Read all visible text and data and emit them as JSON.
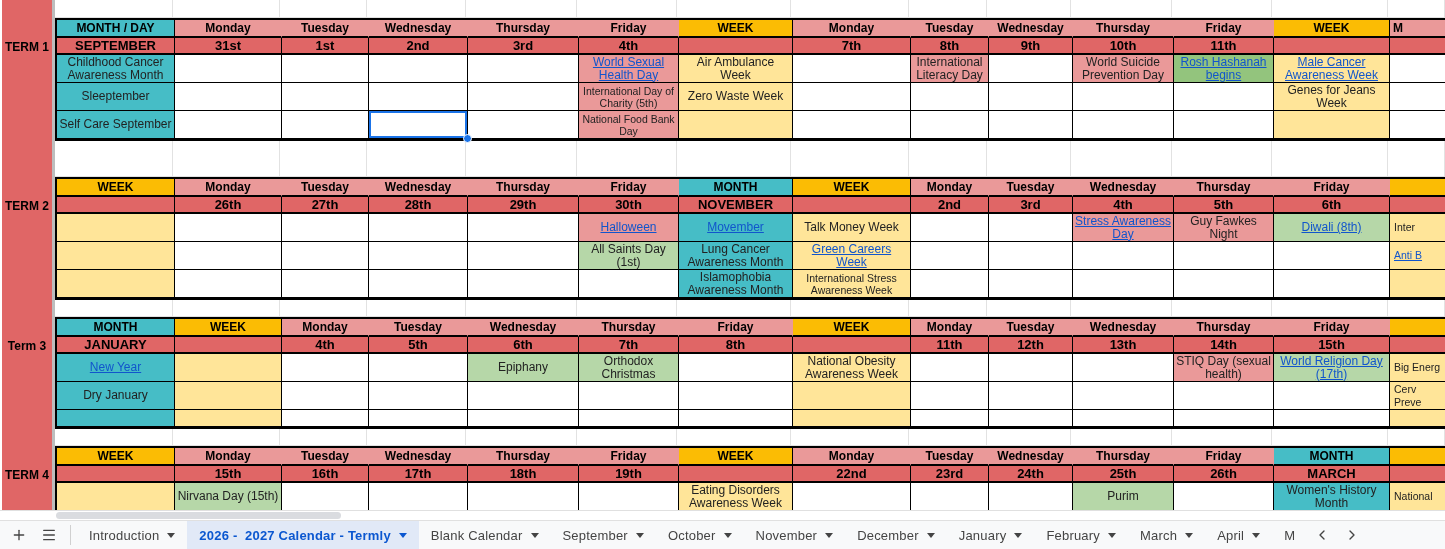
{
  "blocks": [
    {
      "label": "TERM 1",
      "columns": [
        {
          "kind": "month",
          "header": "MONTH / DAY",
          "date": "SEPTEMBER",
          "cells": [
            {
              "text": "Childhood Cancer Awareness Month",
              "selected": false
            },
            {
              "text": "Sleeptember",
              "selected": false
            },
            {
              "text": "Self Care September",
              "selected": false
            }
          ]
        },
        {
          "kind": "day",
          "header": "Monday",
          "date": "31st",
          "cells": [
            {
              "selected": false
            },
            {
              "selected": false
            },
            {
              "selected": false
            }
          ]
        },
        {
          "kind": "day",
          "header": "Tuesday",
          "date": "1st",
          "cells": [
            {
              "selected": false
            },
            {
              "selected": false
            },
            {
              "selected": false
            }
          ]
        },
        {
          "kind": "day",
          "header": "Wednesday",
          "date": "2nd",
          "cells": [
            {
              "selected": false
            },
            {
              "selected": false
            },
            {
              "selected": true
            }
          ]
        },
        {
          "kind": "day",
          "header": "Thursday",
          "date": "3rd",
          "cells": [
            {
              "selected": false
            },
            {
              "selected": false
            },
            {
              "selected": false
            }
          ]
        },
        {
          "kind": "day",
          "header": "Friday",
          "date": "4th",
          "cells": [
            {
              "text": "World Sexual Health Day",
              "link": true,
              "color": "#ea9999",
              "selected": false
            },
            {
              "text": "International Day of Charity (5th)",
              "small": true,
              "color": "#ea9999",
              "selected": false
            },
            {
              "text": "National Food Bank Day",
              "small": true,
              "color": "#ea9999",
              "selected": false
            }
          ]
        },
        {
          "kind": "week",
          "header": "WEEK",
          "cells": [
            {
              "text": "Air Ambulance Week",
              "selected": false
            },
            {
              "text": "Zero Waste Week",
              "selected": false
            },
            {
              "selected": false
            }
          ]
        },
        {
          "kind": "day",
          "header": "Monday",
          "date": "7th",
          "cells": [
            {
              "selected": false
            },
            {
              "selected": false
            },
            {
              "selected": false
            }
          ]
        },
        {
          "kind": "day",
          "header": "Tuesday",
          "date": "8th",
          "cells": [
            {
              "text": "International Literacy Day",
              "color": "#ea9999",
              "selected": false
            },
            {
              "selected": false
            },
            {
              "selected": false
            }
          ]
        },
        {
          "kind": "day",
          "header": "Wednesday",
          "date": "9th",
          "cells": [
            {
              "selected": false
            },
            {
              "selected": false
            },
            {
              "selected": false
            }
          ]
        },
        {
          "kind": "day",
          "header": "Thursday",
          "date": "10th",
          "cells": [
            {
              "text": "World Suicide Prevention Day",
              "color": "#ea9999",
              "selected": false
            },
            {
              "selected": false
            },
            {
              "selected": false
            }
          ]
        },
        {
          "kind": "day",
          "header": "Friday",
          "date": "11th",
          "cells": [
            {
              "text": "Rosh Hashanah begins",
              "link": true,
              "color": "#93c47d",
              "selected": false
            },
            {
              "selected": false
            },
            {
              "selected": false
            }
          ]
        },
        {
          "kind": "week",
          "header": "WEEK",
          "cells": [
            {
              "text": "Male Cancer Awareness Week",
              "link": true,
              "selected": false
            },
            {
              "text": "Genes for Jeans Week",
              "selected": false
            },
            {
              "selected": false
            }
          ]
        },
        {
          "kind": "day",
          "header": "M",
          "cells": [
            {
              "selected": false
            },
            {
              "selected": false
            },
            {
              "selected": false
            }
          ]
        }
      ]
    },
    {
      "label": "TERM 2",
      "columns": [
        {
          "kind": "week",
          "header": "WEEK",
          "cells": [
            {
              "selected": false
            },
            {
              "selected": false
            },
            {
              "selected": false
            }
          ]
        },
        {
          "kind": "day",
          "header": "Monday",
          "date": "26th",
          "cells": [
            {
              "selected": false
            },
            {
              "selected": false
            },
            {
              "selected": false
            }
          ]
        },
        {
          "kind": "day",
          "header": "Tuesday",
          "date": "27th",
          "cells": [
            {
              "selected": false
            },
            {
              "selected": false
            },
            {
              "selected": false
            }
          ]
        },
        {
          "kind": "day",
          "header": "Wednesday",
          "date": "28th",
          "cells": [
            {
              "selected": false
            },
            {
              "selected": false
            },
            {
              "selected": false
            }
          ]
        },
        {
          "kind": "day",
          "header": "Thursday",
          "date": "29th",
          "cells": [
            {
              "selected": false
            },
            {
              "selected": false
            },
            {
              "selected": false
            }
          ]
        },
        {
          "kind": "day",
          "header": "Friday",
          "date": "30th",
          "cells": [
            {
              "text": "Halloween",
              "link": true,
              "color": "#ea9999",
              "selected": false
            },
            {
              "text": "All Saints Day (1st)",
              "color": "#b6d7a8",
              "selected": false
            },
            {
              "selected": false
            }
          ]
        },
        {
          "kind": "month",
          "header": "MONTH",
          "date": "NOVEMBER",
          "cells": [
            {
              "text": "Movember",
              "link": true,
              "selected": false
            },
            {
              "text": "Lung Cancer Awareness Month",
              "selected": false
            },
            {
              "text": "Islamophobia Awareness Month",
              "selected": false
            }
          ]
        },
        {
          "kind": "week",
          "header": "WEEK",
          "cells": [
            {
              "text": "Talk Money Week",
              "selected": false
            },
            {
              "text": "Green Careers Week",
              "link": true,
              "selected": false
            },
            {
              "text": "International Stress Awareness Week",
              "small": true,
              "selected": false
            }
          ]
        },
        {
          "kind": "day",
          "header": "Monday",
          "date": "2nd",
          "cells": [
            {
              "selected": false
            },
            {
              "selected": false
            },
            {
              "selected": false
            }
          ]
        },
        {
          "kind": "day",
          "header": "Tuesday",
          "date": "3rd",
          "cells": [
            {
              "selected": false
            },
            {
              "selected": false
            },
            {
              "selected": false
            }
          ]
        },
        {
          "kind": "day",
          "header": "Wednesday",
          "date": "4th",
          "cells": [
            {
              "text": "Stress Awareness Day",
              "link": true,
              "color": "#ea9999",
              "selected": false
            },
            {
              "selected": false
            },
            {
              "selected": false
            }
          ]
        },
        {
          "kind": "day",
          "header": "Thursday",
          "date": "5th",
          "cells": [
            {
              "text": "Guy Fawkes Night",
              "color": "#ea9999",
              "selected": false
            },
            {
              "selected": false
            },
            {
              "selected": false
            }
          ]
        },
        {
          "kind": "day",
          "header": "Friday",
          "date": "6th",
          "cells": [
            {
              "text": "Diwali (8th)",
              "link": true,
              "color": "#b6d7a8",
              "selected": false
            },
            {
              "selected": false
            },
            {
              "selected": false
            }
          ]
        },
        {
          "kind": "week",
          "cells": [
            {
              "text": "Inter",
              "selected": false
            },
            {
              "text": "Anti B",
              "link": true,
              "selected": false
            },
            {
              "selected": false
            }
          ]
        }
      ]
    },
    {
      "label": "Term 3",
      "columns": [
        {
          "kind": "month",
          "header": "MONTH",
          "date": "JANUARY",
          "cells": [
            {
              "text": "New Year",
              "link": true,
              "selected": false
            },
            {
              "text": "Dry January",
              "selected": false
            },
            {
              "selected": false
            }
          ]
        },
        {
          "kind": "week",
          "header": "WEEK",
          "cells": [
            {
              "selected": false
            },
            {
              "selected": false
            },
            {
              "selected": false
            }
          ]
        },
        {
          "kind": "day",
          "header": "Monday",
          "date": "4th",
          "cells": [
            {
              "selected": false
            },
            {
              "selected": false
            },
            {
              "selected": false
            }
          ]
        },
        {
          "kind": "day",
          "header": "Tuesday",
          "date": "5th",
          "cells": [
            {
              "selected": false
            },
            {
              "selected": false
            },
            {
              "selected": false
            }
          ]
        },
        {
          "kind": "day",
          "header": "Wednesday",
          "date": "6th",
          "cells": [
            {
              "text": "Epiphany",
              "color": "#b6d7a8",
              "selected": false
            },
            {
              "selected": false
            },
            {
              "selected": false
            }
          ]
        },
        {
          "kind": "day",
          "header": "Thursday",
          "date": "7th",
          "cells": [
            {
              "text": "Orthodox Christmas",
              "color": "#b6d7a8",
              "selected": false
            },
            {
              "selected": false
            },
            {
              "selected": false
            }
          ]
        },
        {
          "kind": "day",
          "header": "Friday",
          "date": "8th",
          "cells": [
            {
              "selected": false
            },
            {
              "selected": false
            },
            {
              "selected": false
            }
          ]
        },
        {
          "kind": "week",
          "header": "WEEK",
          "cells": [
            {
              "text": "National Obesity Awareness Week",
              "selected": false
            },
            {
              "selected": false
            },
            {
              "selected": false
            }
          ]
        },
        {
          "kind": "day",
          "header": "Monday",
          "date": "11th",
          "cells": [
            {
              "selected": false
            },
            {
              "selected": false
            },
            {
              "selected": false
            }
          ]
        },
        {
          "kind": "day",
          "header": "Tuesday",
          "date": "12th",
          "cells": [
            {
              "selected": false
            },
            {
              "selected": false
            },
            {
              "selected": false
            }
          ]
        },
        {
          "kind": "day",
          "header": "Wednesday",
          "date": "13th",
          "cells": [
            {
              "selected": false
            },
            {
              "selected": false
            },
            {
              "selected": false
            }
          ]
        },
        {
          "kind": "day",
          "header": "Thursday",
          "date": "14th",
          "cells": [
            {
              "text": "STIQ Day (sexual health)",
              "color": "#ea9999",
              "selected": false
            },
            {
              "selected": false
            },
            {
              "selected": false
            }
          ]
        },
        {
          "kind": "day",
          "header": "Friday",
          "date": "15th",
          "cells": [
            {
              "text": "World Religion Day (17th)",
              "link": true,
              "color": "#b6d7a8",
              "selected": false
            },
            {
              "selected": false
            },
            {
              "selected": false
            }
          ]
        },
        {
          "kind": "week",
          "cells": [
            {
              "text": "Big Energ",
              "selected": false
            },
            {
              "text": "Cerv Preve",
              "selected": false
            },
            {
              "selected": false
            }
          ]
        }
      ]
    },
    {
      "label": "TERM 4",
      "columns": [
        {
          "kind": "week",
          "header": "WEEK",
          "cells": [
            {
              "selected": false
            }
          ]
        },
        {
          "kind": "day",
          "header": "Monday",
          "date": "15th",
          "cells": [
            {
              "text": "Nirvana Day (15th)",
              "color": "#b6d7a8",
              "selected": false
            }
          ]
        },
        {
          "kind": "day",
          "header": "Tuesday",
          "date": "16th",
          "cells": [
            {
              "selected": false
            }
          ]
        },
        {
          "kind": "day",
          "header": "Wednesday",
          "date": "17th",
          "cells": [
            {
              "selected": false
            }
          ]
        },
        {
          "kind": "day",
          "header": "Thursday",
          "date": "18th",
          "cells": [
            {
              "selected": false
            }
          ]
        },
        {
          "kind": "day",
          "header": "Friday",
          "date": "19th",
          "cells": [
            {
              "selected": false
            }
          ]
        },
        {
          "kind": "week",
          "header": "WEEK",
          "cells": [
            {
              "text": "Eating Disorders Awareness Week",
              "selected": false
            }
          ]
        },
        {
          "kind": "day",
          "header": "Monday",
          "date": "22nd",
          "cells": [
            {
              "selected": false
            }
          ]
        },
        {
          "kind": "day",
          "header": "Tuesday",
          "date": "23rd",
          "cells": [
            {
              "selected": false
            }
          ]
        },
        {
          "kind": "day",
          "header": "Wednesday",
          "date": "24th",
          "cells": [
            {
              "selected": false
            }
          ]
        },
        {
          "kind": "day",
          "header": "Thursday",
          "date": "25th",
          "cells": [
            {
              "text": "Purim",
              "color": "#b6d7a8",
              "selected": false
            }
          ]
        },
        {
          "kind": "day",
          "header": "Friday",
          "date": "26th",
          "cells": [
            {
              "selected": false
            }
          ]
        },
        {
          "kind": "month",
          "header": "MONTH",
          "date": "MARCH",
          "cells": [
            {
              "text": "Women's History Month",
              "selected": false
            }
          ]
        },
        {
          "kind": "week",
          "cells": [
            {
              "text": "National",
              "selected": false
            }
          ]
        }
      ]
    }
  ],
  "sheet_tabs": [
    {
      "label": "Introduction",
      "selected": false
    },
    {
      "label": "2026 -  2027 Calendar - Termly",
      "selected": true
    },
    {
      "label": "Blank Calendar",
      "selected": false
    },
    {
      "label": "September",
      "selected": false
    },
    {
      "label": "October",
      "selected": false
    },
    {
      "label": "November",
      "selected": false
    },
    {
      "label": "December",
      "selected": false
    },
    {
      "label": "January",
      "selected": false
    },
    {
      "label": "February",
      "selected": false
    },
    {
      "label": "March",
      "selected": false
    },
    {
      "label": "April",
      "selected": false
    },
    {
      "label": "M",
      "selected": false
    }
  ]
}
